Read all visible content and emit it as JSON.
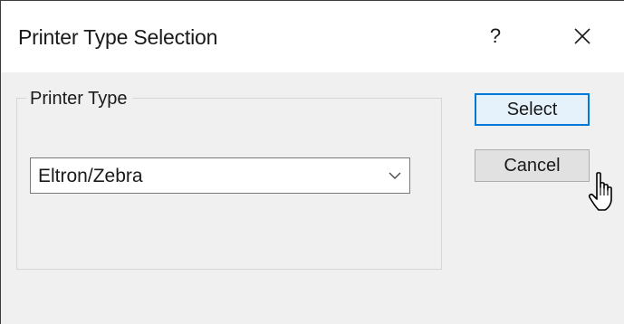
{
  "window": {
    "title": "Printer Type Selection",
    "help_label": "?",
    "close_icon": "close-icon"
  },
  "group": {
    "label": "Printer Type"
  },
  "combo": {
    "selected_value": "Eltron/Zebra",
    "arrow_icon": "chevron-down-icon"
  },
  "buttons": {
    "select_label": "Select",
    "cancel_label": "Cancel"
  },
  "cursor_icon": "hand-pointer-icon",
  "colors": {
    "focus_border": "#0078d7",
    "focus_fill": "#e5f1fb",
    "button_fill": "#e1e1e1",
    "dialog_background": "#f0f0f0"
  }
}
